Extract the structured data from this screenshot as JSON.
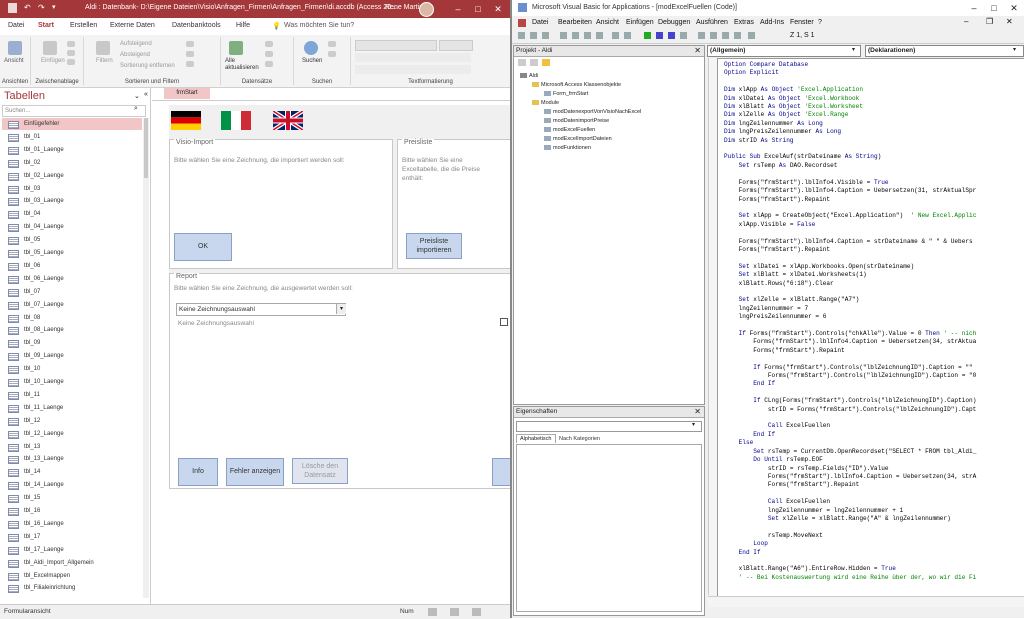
{
  "access": {
    "title": "Aldi : Datenbank- D:\\Eigene Dateien\\Visio\\Anfragen_Firmen\\Anfragen_Firmen\\di.accdb (Access 20...",
    "user": "Rene Martin",
    "menu": [
      "Datei",
      "Start",
      "Erstellen",
      "Externe Daten",
      "Datenbanktools",
      "Hilfe",
      "Was möchten Sie tun?"
    ],
    "ribbon": {
      "ansicht": "Ansicht",
      "einfuegen": "Einfügen",
      "filtern": "Filtern",
      "aufsteigend": "Aufsteigend",
      "absteigend": "Absteigend",
      "sortierung_entfernen": "Sortierung entfernen",
      "alle_aktualisieren": "Alle aktualisieren",
      "suchen": "Suchen",
      "groups": [
        "Ansichten",
        "Zwischenablage",
        "Sortieren und Filtern",
        "Datensätze",
        "Suchen",
        "Textformatierung"
      ]
    },
    "nav": {
      "title": "Tabellen",
      "search_placeholder": "Suchen...",
      "items": [
        "Einfügefehler",
        "tbl_01",
        "tbl_01_Laenge",
        "tbl_02",
        "tbl_02_Laenge",
        "tbl_03",
        "tbl_03_Laenge",
        "tbl_04",
        "tbl_04_Laenge",
        "tbl_05",
        "tbl_05_Laenge",
        "tbl_06",
        "tbl_06_Laenge",
        "tbl_07",
        "tbl_07_Laenge",
        "tbl_08",
        "tbl_08_Laenge",
        "tbl_09",
        "tbl_09_Laenge",
        "tbl_10",
        "tbl_10_Laenge",
        "tbl_11",
        "tbl_11_Laenge",
        "tbl_12",
        "tbl_12_Laenge",
        "tbl_13",
        "tbl_13_Laenge",
        "tbl_14",
        "tbl_14_Laenge",
        "tbl_15",
        "tbl_16",
        "tbl_16_Laenge",
        "tbl_17",
        "tbl_17_Laenge",
        "tbl_Aldi_Import_Allgemein",
        "tbl_Excelmappen",
        "tbl_Filialeinrichtung"
      ]
    },
    "doc_tab": "frmStart",
    "form": {
      "visio_title": "Visio-Import",
      "visio_desc": "Bitte wählen Sie eine Zeichnung, die importiert werden soll:",
      "ok": "OK",
      "preis_title": "Preisliste",
      "preis_desc": "Bitte wählen Sie eine Exceltabelle, die die Preise enthält:",
      "preis_btn": "Preisliste importieren",
      "report_title": "Report",
      "report_desc": "Bitte wählen Sie eine Zeichnung, die ausgewertet werden soll:",
      "combo_value": "Keine Zeichnungsauswahl",
      "combo_label": "Keine Zeichnungsauswahl",
      "info": "Info",
      "fehler": "Fehler anzeigen",
      "loesche": "Lösche den Datensatz"
    },
    "status": {
      "left": "Formularansicht",
      "right": "Num"
    }
  },
  "vba": {
    "title": "Microsoft Visual Basic for Applications - [modExcelFuellen (Code)]",
    "menu": [
      "Datei",
      "Bearbeiten",
      "Ansicht",
      "Einfügen",
      "Debuggen",
      "Ausführen",
      "Extras",
      "Add-Ins",
      "Fenster",
      "?"
    ],
    "cursor_pos": "Z 1, S 1",
    "project": {
      "title": "Projekt - Aldi",
      "tree": [
        "Aldi",
        "Microsoft Access Klassenobjekte",
        "Form_frmStart",
        "Module",
        "modDatenexportVonVisioNachExcel",
        "modDatenimportPreise",
        "modExcelFuellen",
        "modExcelImportDateien",
        "modFunktionen"
      ]
    },
    "props": {
      "title": "Eigenschaften",
      "tab1": "Alphabetisch",
      "tab2": "Nach Kategorien"
    },
    "code": {
      "object": "(Allgemein)",
      "proc": "(Deklarationen)"
    }
  }
}
